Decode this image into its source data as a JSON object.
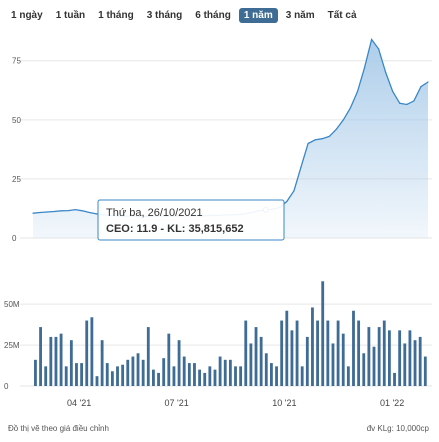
{
  "range_buttons": [
    "1 ngày",
    "1 tuần",
    "1 tháng",
    "3 tháng",
    "6 tháng",
    "1 năm",
    "3 năm",
    "Tất cả"
  ],
  "active_range": "1 năm",
  "tooltip": {
    "date": "Thứ ba, 26/10/2021",
    "line": "CEO: 11.9 - KL: 35,815,652"
  },
  "footer": {
    "note": "Đồ thị vẽ theo giá điều chỉnh",
    "unit": "đv KLg: 10,000cp"
  },
  "colors": {
    "line": "#3a87c8",
    "area": "#a9cbe9",
    "bars": "#3f6c95",
    "active_button": "#3f6c95"
  },
  "chart_data": [
    {
      "type": "area",
      "y_ticks": [
        "0",
        "25",
        "50",
        "75"
      ],
      "ylim": [
        0,
        88
      ],
      "grid": true,
      "x": [
        0,
        1,
        2,
        3,
        4,
        5,
        6,
        7,
        8,
        9,
        10,
        11,
        12,
        13,
        14,
        15,
        16,
        17,
        18,
        19,
        20,
        21,
        22,
        23,
        24,
        25,
        26,
        27,
        28,
        29,
        30,
        31,
        32,
        33,
        34,
        35,
        36,
        37,
        38,
        39,
        40,
        41,
        42,
        43,
        44,
        45,
        46,
        47,
        48,
        49,
        50,
        51,
        52,
        53,
        54,
        55,
        56
      ],
      "values": [
        10.5,
        10.8,
        11,
        11.2,
        11.5,
        11.6,
        12,
        11.5,
        10.8,
        10.2,
        9.8,
        9.5,
        9.3,
        9.2,
        9.3,
        9.1,
        9.2,
        9.2,
        9.3,
        9.2,
        9.4,
        9.3,
        9.3,
        9.5,
        9.4,
        9.6,
        9.5,
        9.7,
        9.8,
        9.9,
        10.2,
        10.8,
        11.5,
        11.9,
        12.2,
        13,
        15.5,
        20,
        30,
        40,
        41.5,
        42,
        43,
        46,
        50,
        55,
        62,
        72,
        84,
        80,
        70,
        62,
        57,
        56.5,
        58,
        64,
        66
      ],
      "tooltip_index": 33
    },
    {
      "type": "bar",
      "y_ticks": [
        "0",
        "25M",
        "50M"
      ],
      "ylim": [
        0,
        55
      ],
      "x_ticks": [
        "04 '21",
        "07 '21",
        "10 '21",
        "01 '22"
      ],
      "values": [
        16,
        36,
        12,
        30,
        30,
        32,
        12,
        28,
        14,
        14,
        40,
        42,
        6,
        28,
        14,
        9,
        12,
        13,
        16,
        18,
        20,
        16,
        36,
        10,
        8,
        17,
        32,
        12,
        28,
        18,
        14,
        14,
        10,
        8,
        12,
        10,
        18,
        16,
        16,
        12,
        12,
        40,
        26,
        36,
        30,
        20,
        14,
        12,
        40,
        46,
        34,
        40,
        12,
        30,
        48,
        40,
        64,
        40,
        26,
        40,
        32,
        12,
        46,
        40,
        20,
        36,
        24,
        36,
        40,
        34,
        8,
        34,
        26,
        34,
        28,
        30,
        18
      ],
      "label_positions": [
        9,
        28,
        49,
        70
      ]
    }
  ]
}
